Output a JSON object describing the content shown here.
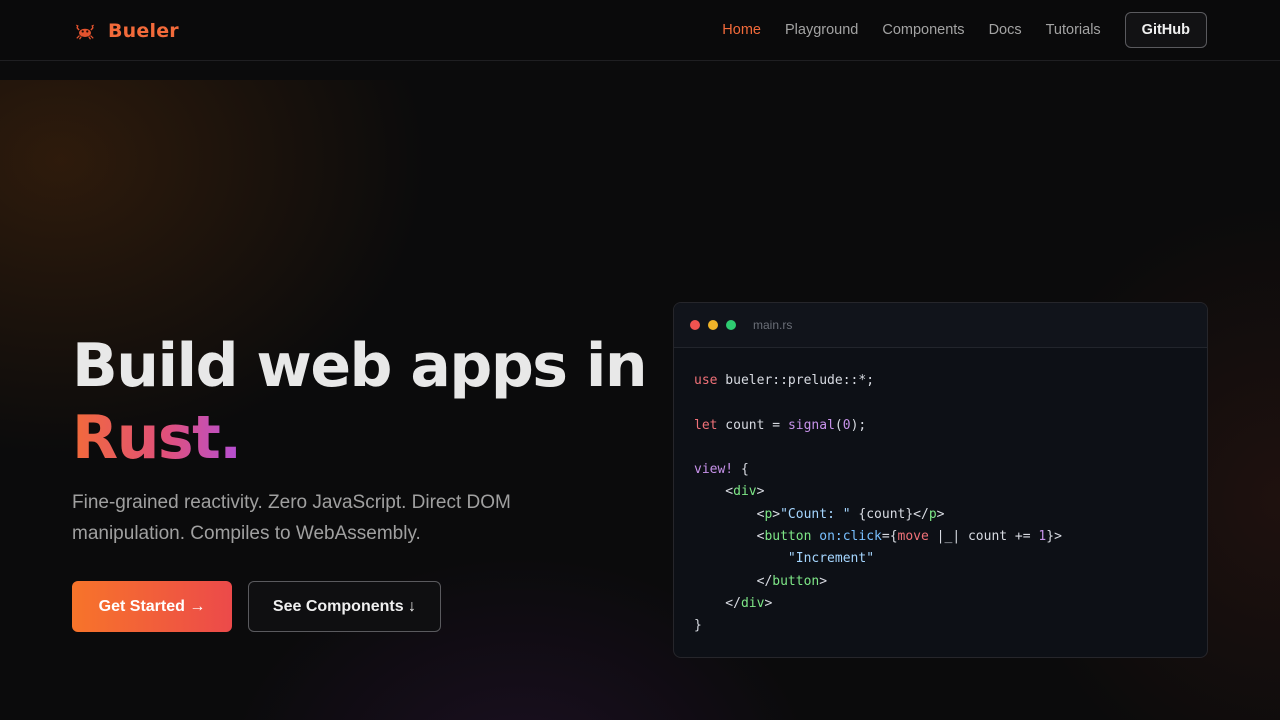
{
  "header": {
    "brand": "Bueler",
    "logo_icon": "crab-icon",
    "nav": [
      {
        "label": "Home",
        "active": true
      },
      {
        "label": "Playground",
        "active": false
      },
      {
        "label": "Components",
        "active": false
      },
      {
        "label": "Docs",
        "active": false
      },
      {
        "label": "Tutorials",
        "active": false
      }
    ],
    "github_label": "GitHub"
  },
  "hero": {
    "title_line1": "Build web apps in",
    "title_accent": "Rust.",
    "subtitle": "Fine-grained reactivity. Zero JavaScript. Direct DOM manipulation. Compiles to WebAssembly.",
    "primary_cta": "Get Started →",
    "secondary_cta": "See Components ↓"
  },
  "code": {
    "filename": "main.rs",
    "lines": [
      [
        {
          "t": "use",
          "c": "kw"
        },
        {
          "t": " bueler::prelude::*;",
          "c": "plain"
        }
      ],
      [],
      [
        {
          "t": "let",
          "c": "kw"
        },
        {
          "t": " count = ",
          "c": "plain"
        },
        {
          "t": "signal",
          "c": "fn"
        },
        {
          "t": "(",
          "c": "plain"
        },
        {
          "t": "0",
          "c": "num"
        },
        {
          "t": ");",
          "c": "plain"
        }
      ],
      [],
      [
        {
          "t": "view!",
          "c": "mac"
        },
        {
          "t": " {",
          "c": "plain"
        }
      ],
      [
        {
          "t": "    <",
          "c": "plain"
        },
        {
          "t": "div",
          "c": "tag"
        },
        {
          "t": ">",
          "c": "plain"
        }
      ],
      [
        {
          "t": "        <",
          "c": "plain"
        },
        {
          "t": "p",
          "c": "tag"
        },
        {
          "t": ">",
          "c": "plain"
        },
        {
          "t": "\"Count: \"",
          "c": "str"
        },
        {
          "t": " {count}</",
          "c": "plain"
        },
        {
          "t": "p",
          "c": "tag"
        },
        {
          "t": ">",
          "c": "plain"
        }
      ],
      [
        {
          "t": "        <",
          "c": "plain"
        },
        {
          "t": "button",
          "c": "tag"
        },
        {
          "t": " ",
          "c": "plain"
        },
        {
          "t": "on:click",
          "c": "attr"
        },
        {
          "t": "={",
          "c": "plain"
        },
        {
          "t": "move",
          "c": "kw"
        },
        {
          "t": " |_| count += ",
          "c": "plain"
        },
        {
          "t": "1",
          "c": "num"
        },
        {
          "t": "}>",
          "c": "plain"
        }
      ],
      [
        {
          "t": "            ",
          "c": "plain"
        },
        {
          "t": "\"Increment\"",
          "c": "str"
        }
      ],
      [
        {
          "t": "        </",
          "c": "plain"
        },
        {
          "t": "button",
          "c": "tag"
        },
        {
          "t": ">",
          "c": "plain"
        }
      ],
      [
        {
          "t": "    </",
          "c": "plain"
        },
        {
          "t": "div",
          "c": "tag"
        },
        {
          "t": ">",
          "c": "plain"
        }
      ],
      [
        {
          "t": "}",
          "c": "plain"
        }
      ]
    ]
  },
  "colors": {
    "accent": "#f26a3a",
    "gradient_start": "#f7742a",
    "gradient_end": "#ec4a4a",
    "background": "#0b0b0c"
  }
}
